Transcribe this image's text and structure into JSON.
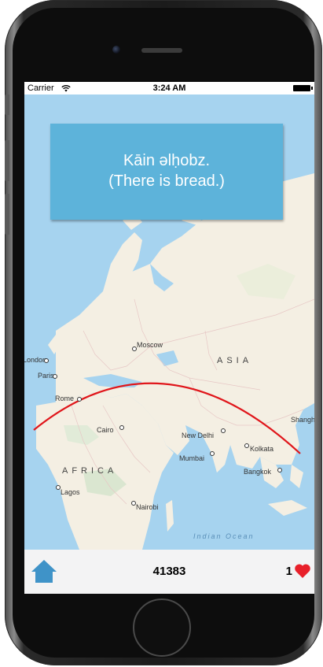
{
  "status_bar": {
    "carrier": "Carrier",
    "time": "3:24 AM"
  },
  "phrase": {
    "original": "Kāin əlḥobz.",
    "translation": "(There is bread.)"
  },
  "map": {
    "region_labels": {
      "asia": "ASIA",
      "africa": "AFRICA",
      "indian_ocean": "Indian Ocean"
    },
    "cities": {
      "moscow": "Moscow",
      "london": "London",
      "paris": "Paris",
      "rome": "Rome",
      "cairo": "Cairo",
      "new_delhi": "New Delhi",
      "mumbai": "Mumbai",
      "kolkata": "Kolkata",
      "bangkok": "Bangkok",
      "shanghai": "Shangh",
      "lagos": "Lagos",
      "nairobi": "Nairobi"
    },
    "colors": {
      "water": "#a6d3ef",
      "land": "#f4efe3",
      "route": "#e0161b"
    }
  },
  "bottom_bar": {
    "home_icon": "house-icon",
    "score": "41383",
    "lives": "1",
    "lives_icon": "heart-icon"
  },
  "colors": {
    "card": "#5db3da",
    "home": "#3f93c8",
    "heart": "#e8202a"
  }
}
